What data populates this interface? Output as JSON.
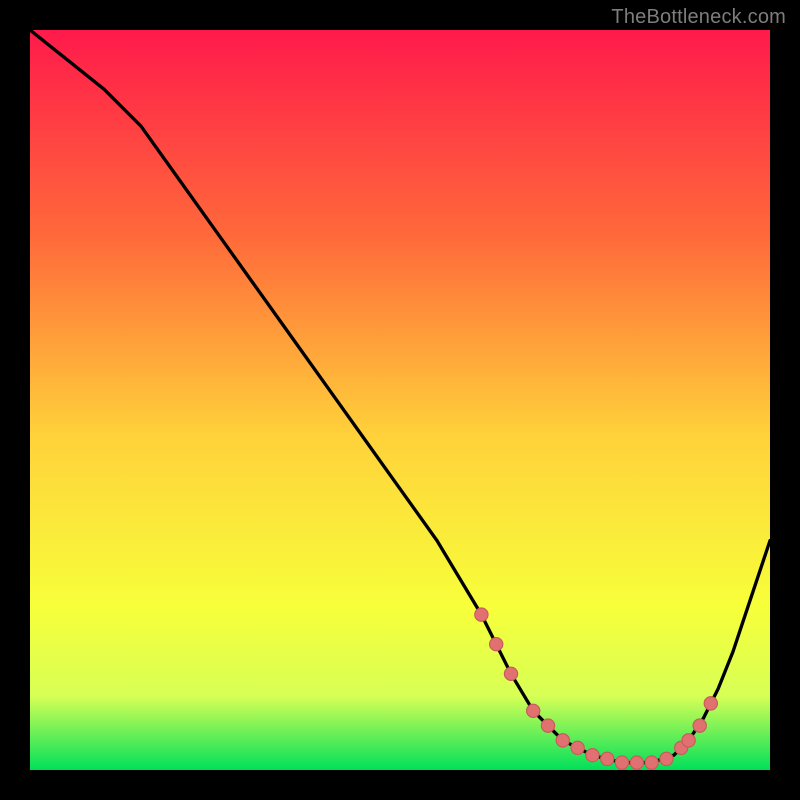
{
  "attribution": "TheBottleneck.com",
  "colors": {
    "gradient_top": "#ff1a4b",
    "gradient_mid_upper": "#ff6a3a",
    "gradient_mid": "#ffd23a",
    "gradient_mid_lower": "#f7ff3a",
    "gradient_lower": "#d7ff55",
    "gradient_bottom": "#00e05a",
    "curve": "#000000",
    "dot_fill": "#e17070",
    "dot_stroke": "#c85a5a"
  },
  "chart_data": {
    "type": "line",
    "title": "",
    "xlabel": "",
    "ylabel": "",
    "xlim": [
      0,
      100
    ],
    "ylim": [
      0,
      100
    ],
    "curve": {
      "name": "bottleneck-curve",
      "x": [
        0,
        5,
        10,
        15,
        20,
        25,
        30,
        35,
        40,
        45,
        50,
        55,
        58,
        61,
        63,
        65,
        68,
        72,
        76,
        80,
        84,
        87,
        89,
        91,
        93,
        95,
        97,
        100
      ],
      "y": [
        100,
        96,
        92,
        87,
        80,
        73,
        66,
        59,
        52,
        45,
        38,
        31,
        26,
        21,
        17,
        13,
        8,
        4,
        2,
        1,
        1,
        2,
        4,
        7,
        11,
        16,
        22,
        31
      ]
    },
    "dots": {
      "name": "valley-dots",
      "x": [
        61,
        63,
        65,
        68,
        70,
        72,
        74,
        76,
        78,
        80,
        82,
        84,
        86,
        88,
        89,
        90.5,
        92
      ],
      "y": [
        21,
        17,
        13,
        8,
        6,
        4,
        3,
        2,
        1.5,
        1,
        1,
        1,
        1.5,
        3,
        4,
        6,
        9
      ]
    }
  }
}
